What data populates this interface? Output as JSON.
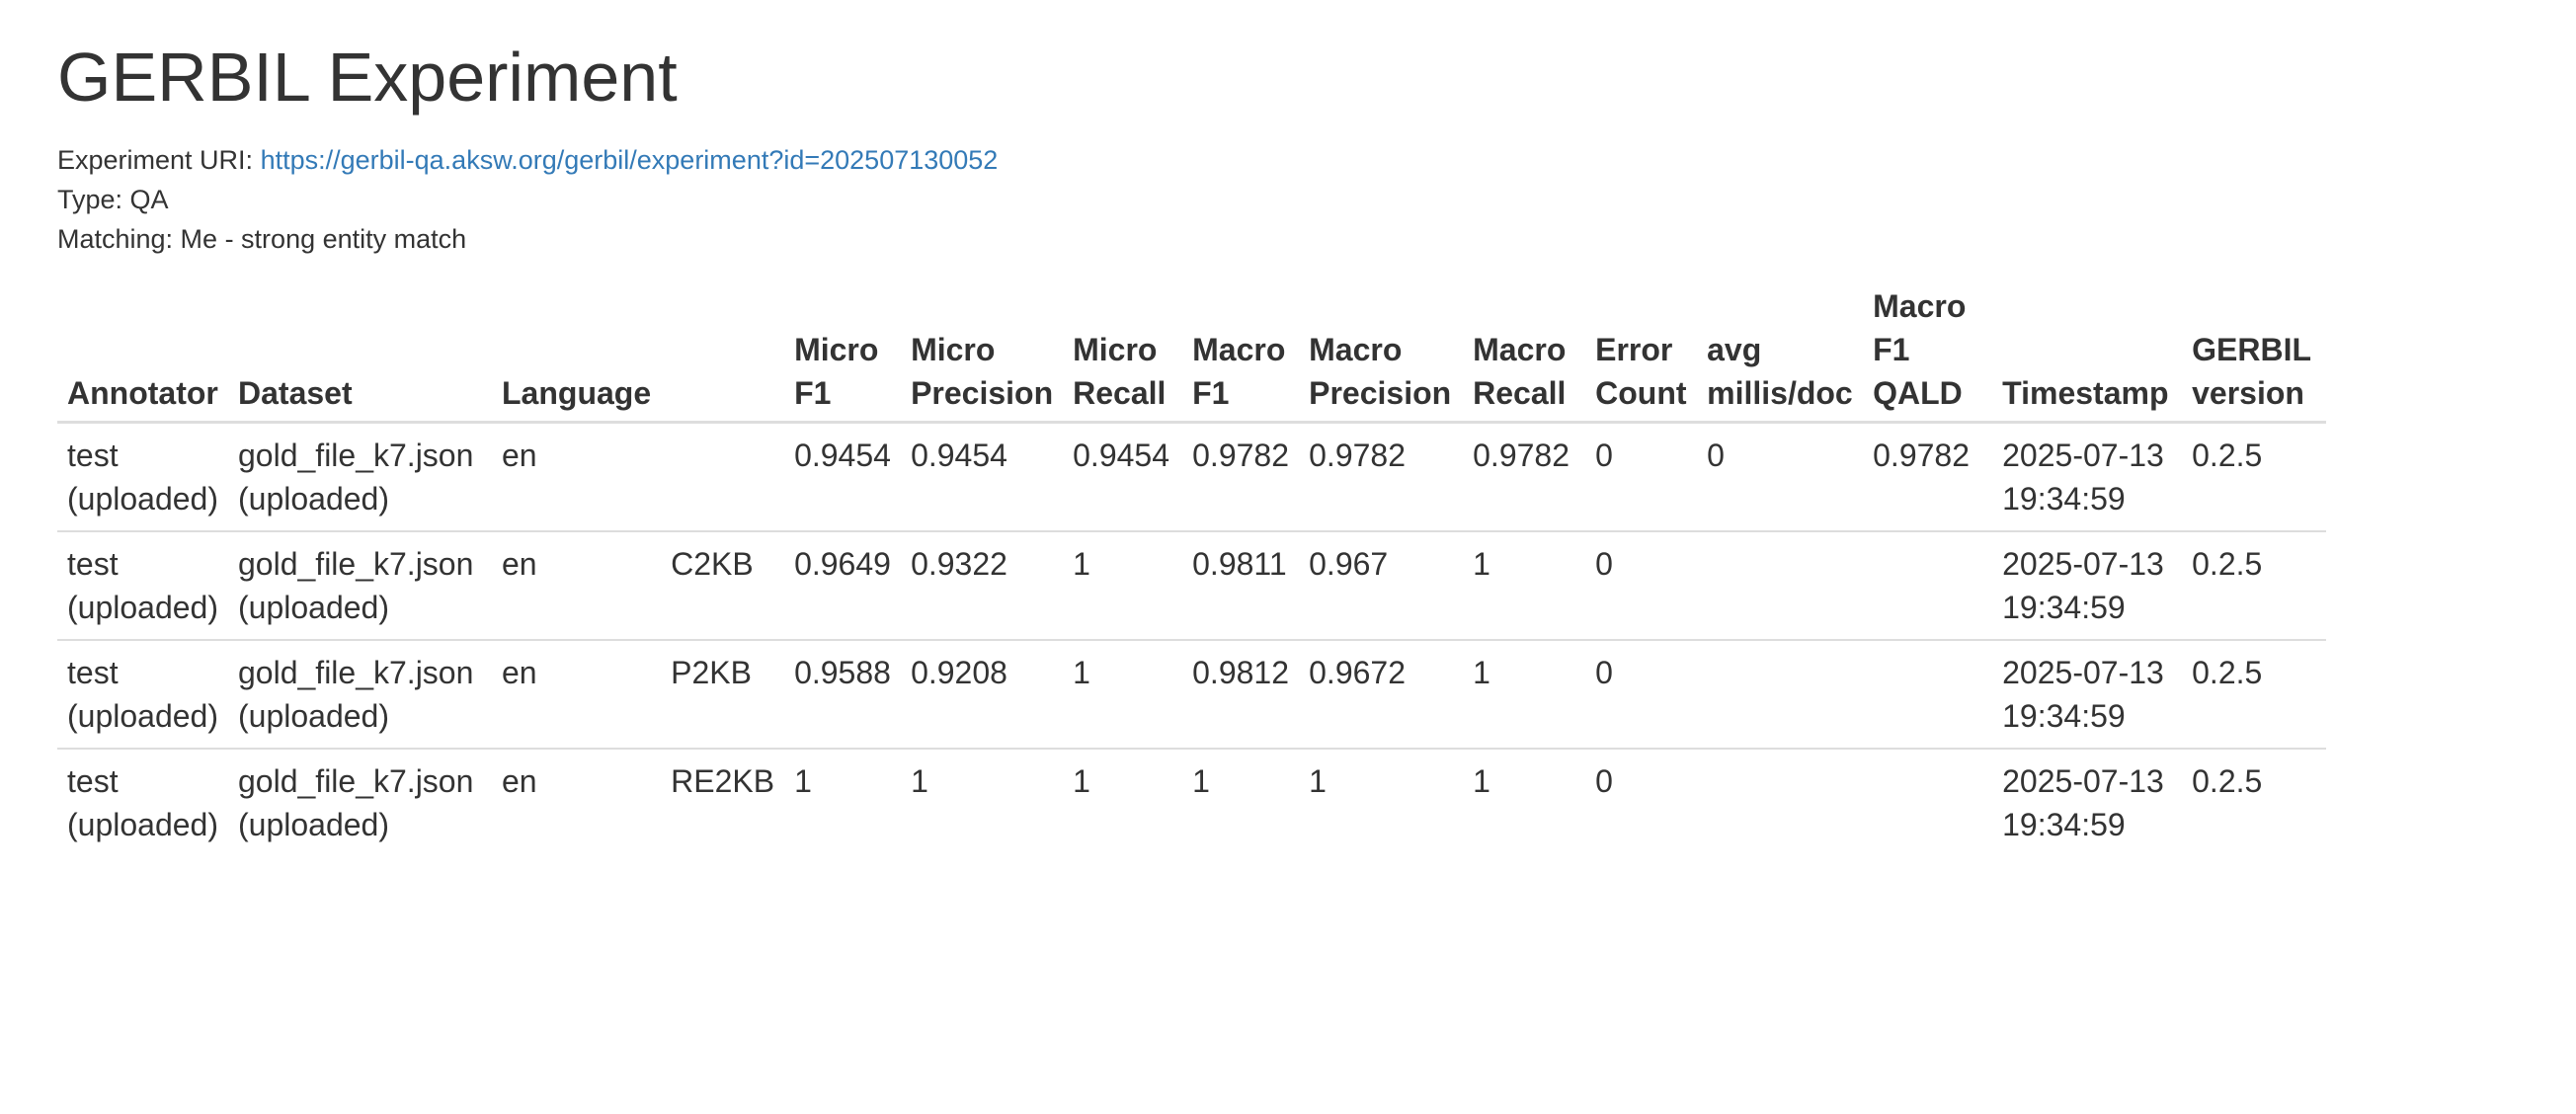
{
  "page": {
    "title": "GERBIL Experiment",
    "uri_label": "Experiment URI:",
    "uri_value": "https://gerbil-qa.aksw.org/gerbil/experiment?id=202507130052",
    "type_label": "Type: QA",
    "matching_label": "Matching: Me - strong entity match"
  },
  "table": {
    "headers": [
      "Annotator",
      "Dataset",
      "Language",
      "",
      "Micro F1",
      "Micro Precision",
      "Micro Recall",
      "Macro F1",
      "Macro Precision",
      "Macro Recall",
      "Error Count",
      "avg millis/doc",
      "Macro F1 QALD",
      "Timestamp",
      "GERBIL version"
    ],
    "rows": [
      [
        "test (uploaded)",
        "gold_file_k7.json (uploaded)",
        "en",
        "",
        "0.9454",
        "0.9454",
        "0.9454",
        "0.9782",
        "0.9782",
        "0.9782",
        "0",
        "0",
        "0.9782",
        "2025-07-13 19:34:59",
        "0.2.5"
      ],
      [
        "test (uploaded)",
        "gold_file_k7.json (uploaded)",
        "en",
        "C2KB",
        "0.9649",
        "0.9322",
        "1",
        "0.9811",
        "0.967",
        "1",
        "0",
        "",
        "",
        "2025-07-13 19:34:59",
        "0.2.5"
      ],
      [
        "test (uploaded)",
        "gold_file_k7.json (uploaded)",
        "en",
        "P2KB",
        "0.9588",
        "0.9208",
        "1",
        "0.9812",
        "0.9672",
        "1",
        "0",
        "",
        "",
        "2025-07-13 19:34:59",
        "0.2.5"
      ],
      [
        "test (uploaded)",
        "gold_file_k7.json (uploaded)",
        "en",
        "RE2KB",
        "1",
        "1",
        "1",
        "1",
        "1",
        "1",
        "0",
        "",
        "",
        "2025-07-13 19:34:59",
        "0.2.5"
      ]
    ]
  }
}
